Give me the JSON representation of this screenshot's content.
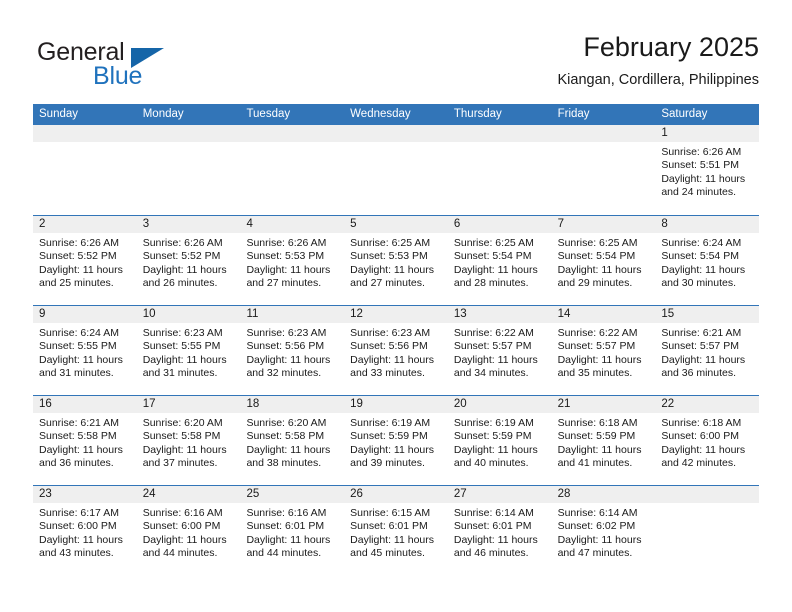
{
  "brand": {
    "name_part1": "General",
    "name_part2": "Blue",
    "logo_icon": "triangle-icon"
  },
  "header": {
    "title": "February 2025",
    "subtitle": "Kiangan, Cordillera, Philippines"
  },
  "calendar": {
    "day_headers": [
      "Sunday",
      "Monday",
      "Tuesday",
      "Wednesday",
      "Thursday",
      "Friday",
      "Saturday"
    ],
    "colors": {
      "header_blue": "#3275b8",
      "brand_blue": "#1f72bd",
      "day_band_gray": "#efefef",
      "text": "#1a1a1a"
    },
    "labels": {
      "sunrise": "Sunrise:",
      "sunset": "Sunset:",
      "daylight": "Daylight:"
    },
    "weeks": [
      [
        {
          "day": "",
          "empty": true
        },
        {
          "day": "",
          "empty": true
        },
        {
          "day": "",
          "empty": true
        },
        {
          "day": "",
          "empty": true
        },
        {
          "day": "",
          "empty": true
        },
        {
          "day": "",
          "empty": true
        },
        {
          "day": "1",
          "sunrise": "Sunrise: 6:26 AM",
          "sunset": "Sunset: 5:51 PM",
          "daylight": "Daylight: 11 hours and 24 minutes."
        }
      ],
      [
        {
          "day": "2",
          "sunrise": "Sunrise: 6:26 AM",
          "sunset": "Sunset: 5:52 PM",
          "daylight": "Daylight: 11 hours and 25 minutes."
        },
        {
          "day": "3",
          "sunrise": "Sunrise: 6:26 AM",
          "sunset": "Sunset: 5:52 PM",
          "daylight": "Daylight: 11 hours and 26 minutes."
        },
        {
          "day": "4",
          "sunrise": "Sunrise: 6:26 AM",
          "sunset": "Sunset: 5:53 PM",
          "daylight": "Daylight: 11 hours and 27 minutes."
        },
        {
          "day": "5",
          "sunrise": "Sunrise: 6:25 AM",
          "sunset": "Sunset: 5:53 PM",
          "daylight": "Daylight: 11 hours and 27 minutes."
        },
        {
          "day": "6",
          "sunrise": "Sunrise: 6:25 AM",
          "sunset": "Sunset: 5:54 PM",
          "daylight": "Daylight: 11 hours and 28 minutes."
        },
        {
          "day": "7",
          "sunrise": "Sunrise: 6:25 AM",
          "sunset": "Sunset: 5:54 PM",
          "daylight": "Daylight: 11 hours and 29 minutes."
        },
        {
          "day": "8",
          "sunrise": "Sunrise: 6:24 AM",
          "sunset": "Sunset: 5:54 PM",
          "daylight": "Daylight: 11 hours and 30 minutes."
        }
      ],
      [
        {
          "day": "9",
          "sunrise": "Sunrise: 6:24 AM",
          "sunset": "Sunset: 5:55 PM",
          "daylight": "Daylight: 11 hours and 31 minutes."
        },
        {
          "day": "10",
          "sunrise": "Sunrise: 6:23 AM",
          "sunset": "Sunset: 5:55 PM",
          "daylight": "Daylight: 11 hours and 31 minutes."
        },
        {
          "day": "11",
          "sunrise": "Sunrise: 6:23 AM",
          "sunset": "Sunset: 5:56 PM",
          "daylight": "Daylight: 11 hours and 32 minutes."
        },
        {
          "day": "12",
          "sunrise": "Sunrise: 6:23 AM",
          "sunset": "Sunset: 5:56 PM",
          "daylight": "Daylight: 11 hours and 33 minutes."
        },
        {
          "day": "13",
          "sunrise": "Sunrise: 6:22 AM",
          "sunset": "Sunset: 5:57 PM",
          "daylight": "Daylight: 11 hours and 34 minutes."
        },
        {
          "day": "14",
          "sunrise": "Sunrise: 6:22 AM",
          "sunset": "Sunset: 5:57 PM",
          "daylight": "Daylight: 11 hours and 35 minutes."
        },
        {
          "day": "15",
          "sunrise": "Sunrise: 6:21 AM",
          "sunset": "Sunset: 5:57 PM",
          "daylight": "Daylight: 11 hours and 36 minutes."
        }
      ],
      [
        {
          "day": "16",
          "sunrise": "Sunrise: 6:21 AM",
          "sunset": "Sunset: 5:58 PM",
          "daylight": "Daylight: 11 hours and 36 minutes."
        },
        {
          "day": "17",
          "sunrise": "Sunrise: 6:20 AM",
          "sunset": "Sunset: 5:58 PM",
          "daylight": "Daylight: 11 hours and 37 minutes."
        },
        {
          "day": "18",
          "sunrise": "Sunrise: 6:20 AM",
          "sunset": "Sunset: 5:58 PM",
          "daylight": "Daylight: 11 hours and 38 minutes."
        },
        {
          "day": "19",
          "sunrise": "Sunrise: 6:19 AM",
          "sunset": "Sunset: 5:59 PM",
          "daylight": "Daylight: 11 hours and 39 minutes."
        },
        {
          "day": "20",
          "sunrise": "Sunrise: 6:19 AM",
          "sunset": "Sunset: 5:59 PM",
          "daylight": "Daylight: 11 hours and 40 minutes."
        },
        {
          "day": "21",
          "sunrise": "Sunrise: 6:18 AM",
          "sunset": "Sunset: 5:59 PM",
          "daylight": "Daylight: 11 hours and 41 minutes."
        },
        {
          "day": "22",
          "sunrise": "Sunrise: 6:18 AM",
          "sunset": "Sunset: 6:00 PM",
          "daylight": "Daylight: 11 hours and 42 minutes."
        }
      ],
      [
        {
          "day": "23",
          "sunrise": "Sunrise: 6:17 AM",
          "sunset": "Sunset: 6:00 PM",
          "daylight": "Daylight: 11 hours and 43 minutes."
        },
        {
          "day": "24",
          "sunrise": "Sunrise: 6:16 AM",
          "sunset": "Sunset: 6:00 PM",
          "daylight": "Daylight: 11 hours and 44 minutes."
        },
        {
          "day": "25",
          "sunrise": "Sunrise: 6:16 AM",
          "sunset": "Sunset: 6:01 PM",
          "daylight": "Daylight: 11 hours and 44 minutes."
        },
        {
          "day": "26",
          "sunrise": "Sunrise: 6:15 AM",
          "sunset": "Sunset: 6:01 PM",
          "daylight": "Daylight: 11 hours and 45 minutes."
        },
        {
          "day": "27",
          "sunrise": "Sunrise: 6:14 AM",
          "sunset": "Sunset: 6:01 PM",
          "daylight": "Daylight: 11 hours and 46 minutes."
        },
        {
          "day": "28",
          "sunrise": "Sunrise: 6:14 AM",
          "sunset": "Sunset: 6:02 PM",
          "daylight": "Daylight: 11 hours and 47 minutes."
        },
        {
          "day": "",
          "empty": true
        }
      ]
    ]
  }
}
